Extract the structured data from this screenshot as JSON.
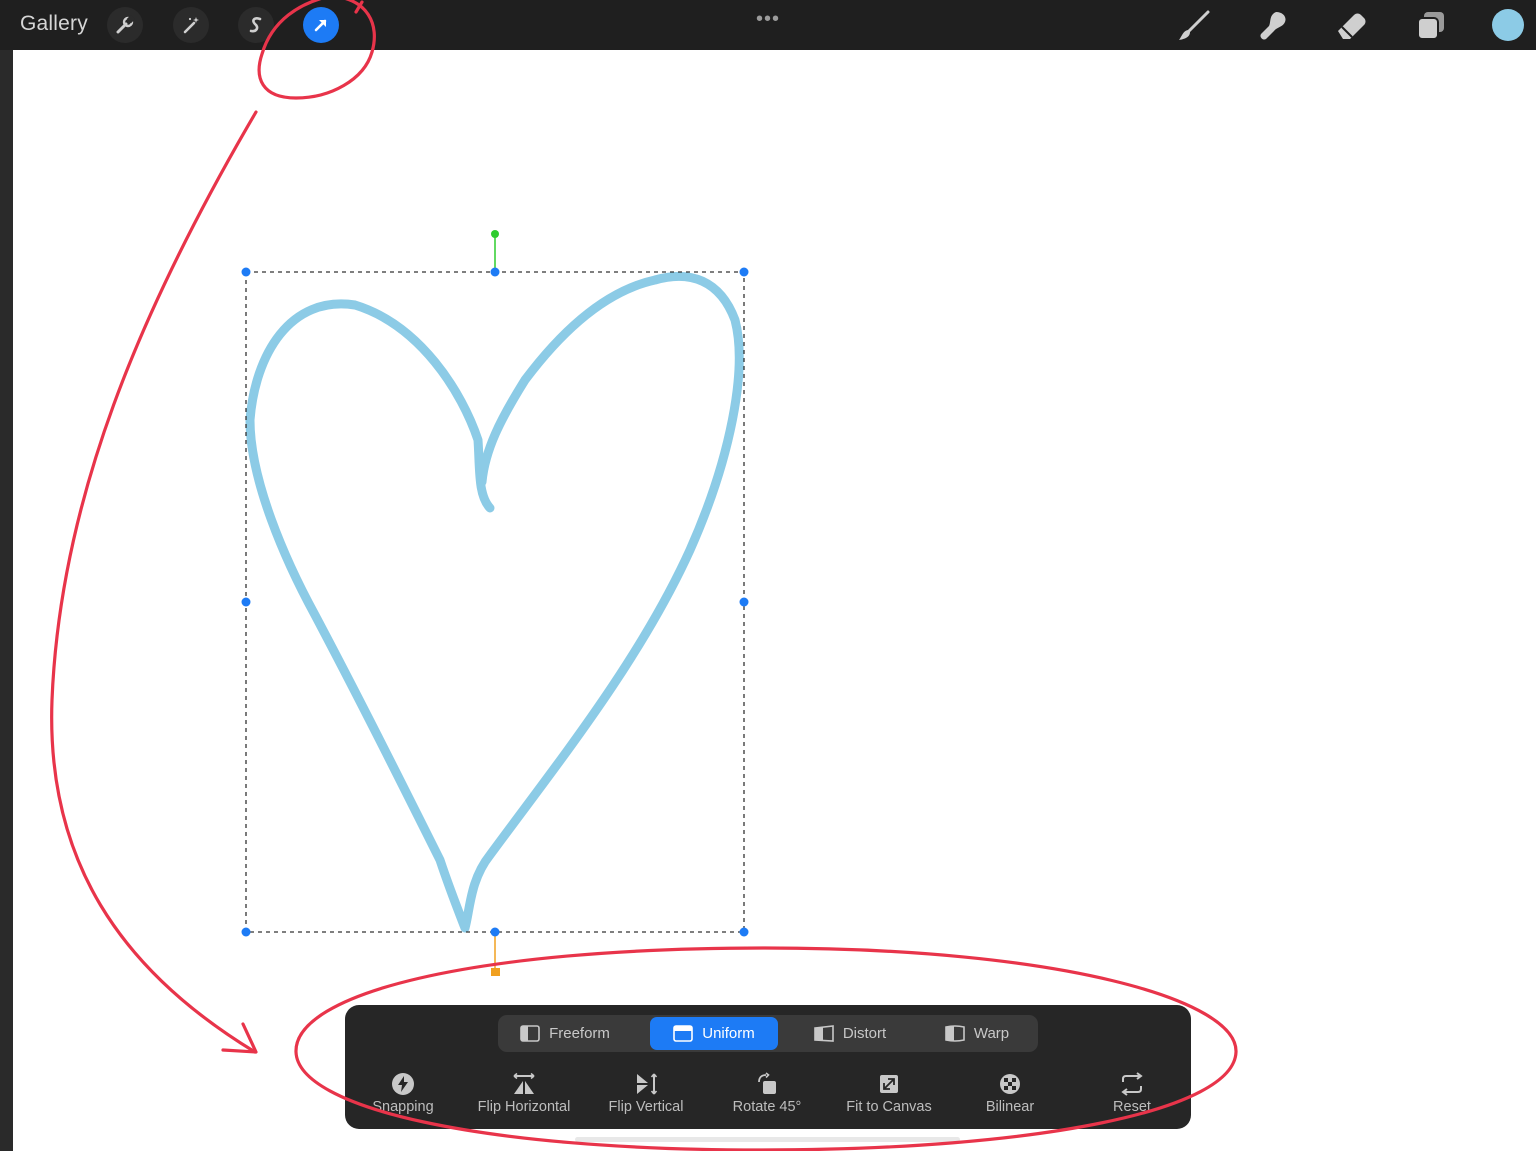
{
  "toolbar": {
    "gallery_label": "Gallery",
    "more_label": "•••",
    "left_tools": [
      "wrench-icon",
      "magic-wand-icon",
      "selection-s-icon",
      "transform-arrow-icon"
    ],
    "active_tool": "transform-arrow-icon",
    "right_tools": [
      "brush-icon",
      "smudge-icon",
      "eraser-icon",
      "layers-icon"
    ],
    "current_color": "#8ccbe6"
  },
  "canvas": {
    "stroke_color": "#8ccbe6",
    "selection_handle_color": "#1d7bf5",
    "rotation_handle_color": "#2ecc2e",
    "pivot_handle_color": "#f0a020",
    "annotation_color": "#e8344a"
  },
  "transform": {
    "modes": [
      {
        "label": "Freeform",
        "icon": "freeform-icon"
      },
      {
        "label": "Uniform",
        "icon": "uniform-icon"
      },
      {
        "label": "Distort",
        "icon": "distort-icon"
      },
      {
        "label": "Warp",
        "icon": "warp-icon"
      }
    ],
    "active_mode": "Uniform",
    "actions": [
      {
        "label": "Snapping",
        "icon": "snapping-icon"
      },
      {
        "label": "Flip Horizontal",
        "icon": "flip-horizontal-icon"
      },
      {
        "label": "Flip Vertical",
        "icon": "flip-vertical-icon"
      },
      {
        "label": "Rotate 45°",
        "icon": "rotate-icon"
      },
      {
        "label": "Fit to Canvas",
        "icon": "fit-canvas-icon"
      },
      {
        "label": "Bilinear",
        "icon": "bilinear-icon"
      },
      {
        "label": "Reset",
        "icon": "reset-icon"
      }
    ]
  }
}
